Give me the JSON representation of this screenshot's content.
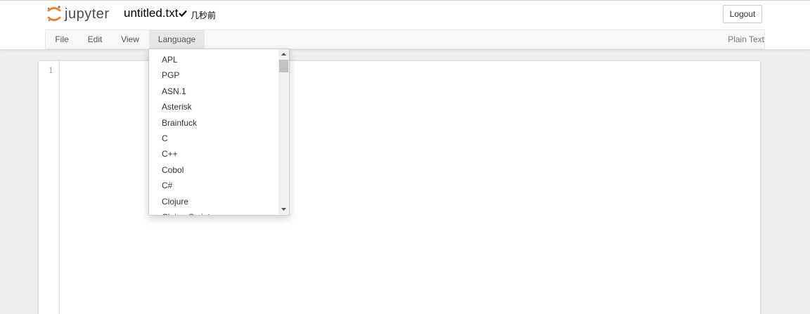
{
  "header": {
    "logo_text": "jupyter",
    "filename": "untitled.txt",
    "save_status": "几秒前",
    "logout_label": "Logout"
  },
  "menubar": {
    "items": [
      {
        "label": "File"
      },
      {
        "label": "Edit"
      },
      {
        "label": "View"
      },
      {
        "label": "Language"
      }
    ],
    "mode": "Plain Text"
  },
  "editor": {
    "line_numbers": [
      "1"
    ]
  },
  "language_menu": {
    "items": [
      "APL",
      "PGP",
      "ASN.1",
      "Asterisk",
      "Brainfuck",
      "C",
      "C++",
      "Cobol",
      "C#",
      "Clojure",
      "ClojureScript"
    ]
  },
  "colors": {
    "logo_orange": "#f37726",
    "logo_gray": "#989798",
    "active_menu_bg": "#e7e7e7"
  },
  "icons": {
    "logo": "jupyter-logo-icon",
    "saved": "checkmark-icon",
    "scroll_up": "arrow-up-icon",
    "scroll_down": "arrow-down-icon"
  }
}
